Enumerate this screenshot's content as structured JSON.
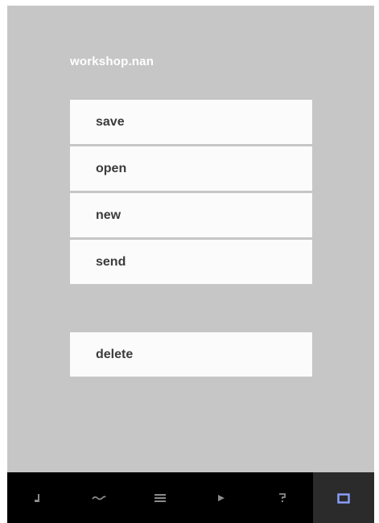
{
  "file": {
    "title": "workshop.nan"
  },
  "menu": {
    "items": [
      {
        "label": "save"
      },
      {
        "label": "open"
      },
      {
        "label": "new"
      },
      {
        "label": "send"
      }
    ],
    "delete_label": "delete"
  },
  "tabbar": {
    "tabs": [
      {
        "icon": "music-note-icon",
        "active": false
      },
      {
        "icon": "wave-icon",
        "active": false
      },
      {
        "icon": "list-icon",
        "active": false
      },
      {
        "icon": "play-icon",
        "active": false
      },
      {
        "icon": "help-icon",
        "active": false
      },
      {
        "icon": "folder-icon",
        "active": true
      }
    ],
    "icon_color": "#8a8a8a",
    "active_icon_color": "#8ca0ff",
    "active_bg": "#2b2b2b"
  },
  "colors": {
    "screen_bg": "#c6c6c6",
    "item_bg": "#fbfbfb",
    "item_text": "#3b3b3b",
    "title_text": "#ffffff"
  }
}
